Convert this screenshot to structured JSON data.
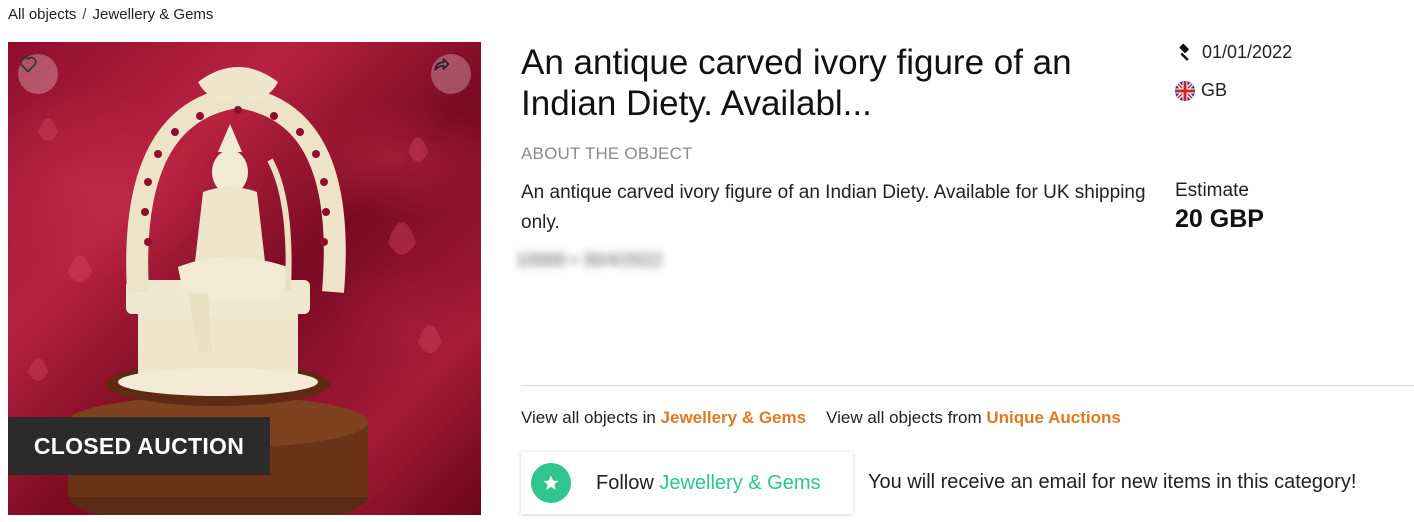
{
  "breadcrumb": {
    "items": [
      "All objects",
      "Jewellery & Gems"
    ],
    "separator": "/"
  },
  "image": {
    "badge": "CLOSED AUCTION",
    "favorite_icon": "heart-icon",
    "share_icon": "share-arrow-icon"
  },
  "lot": {
    "title": "An antique carved ivory figure of an Indian Diety. Availabl...",
    "date": "01/01/2022",
    "date_icon": "gavel-icon",
    "country": "GB",
    "country_icon": "uk-flag-icon",
    "about_heading": "ABOUT THE OBJECT",
    "description": "An antique carved ivory figure of an Indian Diety. Available for UK shipping only.",
    "blurred_text": "10000 • 30/4/2022"
  },
  "estimate": {
    "label": "Estimate",
    "value": "20 GBP"
  },
  "links": {
    "category_prefix": "View all objects in ",
    "category": "Jewellery & Gems",
    "seller_prefix": "View all objects from ",
    "seller": "Unique Auctions"
  },
  "follow": {
    "prefix": "Follow ",
    "category": "Jewellery & Gems",
    "icon": "star-icon",
    "info": "You will receive an email for new items in this category!"
  },
  "colors": {
    "accent_orange": "#e07a21",
    "accent_green": "#2ec58f",
    "badge_bg": "#2b2b2b"
  }
}
